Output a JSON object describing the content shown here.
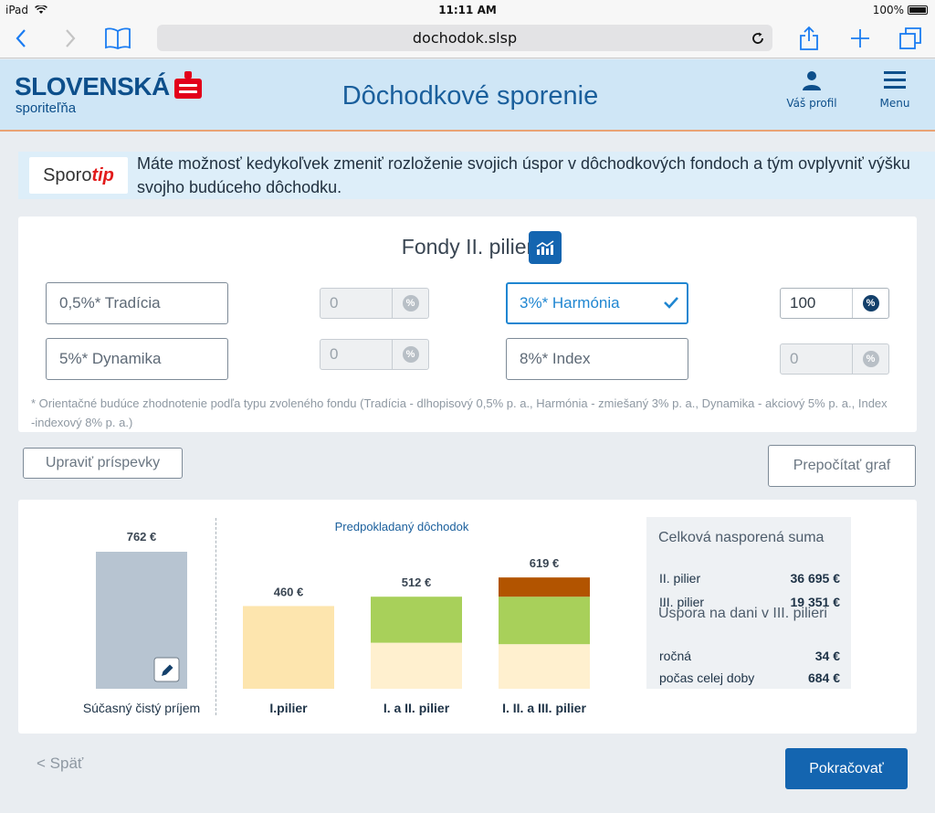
{
  "status_bar": {
    "device": "iPad",
    "time": "11:11 AM",
    "battery": "100%"
  },
  "browser": {
    "url": "dochodok.slsp"
  },
  "header": {
    "logo_main": "SLOVENSKÁ",
    "logo_sub": "sporiteľňa",
    "title": "Dôchodkové sporenie",
    "profile_label": "Váš profil",
    "menu_label": "Menu"
  },
  "tip": {
    "logo_left": "Sporo",
    "logo_right": "tip",
    "text": "Máte možnosť kedykoľvek zmeniť rozloženie svojich úspor v dôchodkových fondoch a tým ovplyvniť výšku svojho budúceho dôchodku."
  },
  "funds": {
    "title": "Fondy II. pilier",
    "items": [
      {
        "label": "0,5%* Tradícia",
        "value": "0",
        "selected": false
      },
      {
        "label": "3%* Harmónia",
        "value": "100",
        "selected": true
      },
      {
        "label": "5%*  Dynamika",
        "value": "0",
        "selected": false
      },
      {
        "label": "8%* Index",
        "value": "0",
        "selected": false
      }
    ],
    "percent_symbol": "%",
    "footnote": "* Orientačné budúce zhodnotenie podľa typu zvoleného fondu (Tradícia - dlhopisový 0,5% p. a., Harmónia - zmiešaný 3% p. a., Dynamika - akciový 5% p. a., Index -indexový 8% p. a.)"
  },
  "actions": {
    "adjust_contributions": "Upraviť príspevky",
    "recalculate_chart": "Prepočítať graf",
    "back": "< Späť",
    "continue": "Pokračovať"
  },
  "chart_data": {
    "type": "bar",
    "title": "Predpokladaný dôchodok",
    "income": {
      "label": "Súčasný čistý príjem",
      "value": 762,
      "value_label": "762 €"
    },
    "categories": [
      "I.pilier",
      "I. a II. pilier",
      "I. II. a III. pilier"
    ],
    "totals_labels": [
      "460 €",
      "512 €",
      "619 €"
    ],
    "totals": [
      460,
      512,
      619
    ],
    "series": [
      {
        "values": [
          460,
          256,
          248
        ],
        "color": "#fde7b3"
      },
      {
        "values": [
          0,
          256,
          264
        ],
        "color": "#a8d05a"
      },
      {
        "values": [
          0,
          0,
          107
        ],
        "color": "#b25400"
      }
    ],
    "ylim": [
      0,
      762
    ],
    "colors": {
      "income": "#b7c4d1",
      "first_pillar_only": "#fde5ae",
      "first_pillar": "#fff0cf"
    }
  },
  "summary": {
    "total_title": "Celková nasporená suma",
    "rows_total": [
      {
        "key": "II. pilier",
        "value": "36 695 €"
      },
      {
        "key": "III. pilier",
        "value": "19 351 €"
      }
    ],
    "tax_title": "Úspora na dani v III. pilieri",
    "rows_tax": [
      {
        "key": "ročná",
        "value": "34 €"
      },
      {
        "key": "počas celej doby",
        "value": "684 €"
      }
    ]
  }
}
